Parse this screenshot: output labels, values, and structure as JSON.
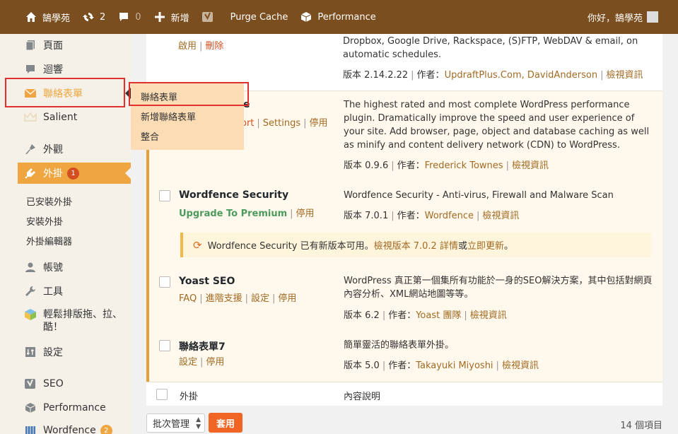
{
  "adminbar": {
    "site_name": "鵠學苑",
    "updates_count": "2",
    "comments_count": "0",
    "new_label": "新增",
    "purge_cache": "Purge Cache",
    "performance": "Performance",
    "greeting": "你好，鵠學苑"
  },
  "sidebar": {
    "pages": "頁面",
    "comments": "迴響",
    "contact_forms": "聯絡表單",
    "salient": "Salient",
    "appearance": "外觀",
    "plugins": "外掛",
    "plugins_badge": "1",
    "installed_plugins": "已安裝外掛",
    "add_plugin": "安裝外掛",
    "plugin_editor": "外掛編輯器",
    "users": "帳號",
    "tools": "工具",
    "builder_line1": "輕鬆排版拖、拉、",
    "builder_line2": "酷！",
    "settings": "設定",
    "seo": "SEO",
    "performance": "Performance",
    "wordfence": "Wordfence",
    "wordfence_badge": "2"
  },
  "flyout": {
    "item1": "聯絡表單",
    "item2": "新增聯絡表單",
    "item3": "整合"
  },
  "plugins": {
    "updraft": {
      "action_enable": "啟用",
      "action_delete": "刪除",
      "desc": "Dropbox, Google Drive, Rackspace, (S)FTP, WebDAV & email, on automatic schedules.",
      "version": "版本 2.14.2.22",
      "author_label": "作者：",
      "author": "UpdraftPlus.Com, DavidAnderson",
      "details": "檢視資訊"
    },
    "w3tc": {
      "name_fragment": "he",
      "action_support_fragment": "ort",
      "action_settings": "Settings",
      "action_deactivate": "停用",
      "desc": "The highest rated and most complete WordPress performance plugin. Dramatically improve the speed and user experience of your site. Add browser, page, object and database caching as well as minify and content delivery network (CDN) to WordPress.",
      "version": "版本 0.9.6",
      "author_label": "作者：",
      "author": "Frederick Townes",
      "details": "檢視資訊"
    },
    "wordfence": {
      "name": "Wordfence Security",
      "action_premium": "Upgrade To Premium",
      "action_deactivate": "停用",
      "desc": "Wordfence Security - Anti-virus, Firewall and Malware Scan",
      "version": "版本 7.0.1",
      "author_label": "作者：",
      "author": "Wordfence",
      "details": "檢視資訊",
      "update_text": "Wordfence Security 已有新版本可用。",
      "update_link1": "檢視版本 7.0.2 詳情",
      "update_or": "或",
      "update_link2": "立即更新",
      "update_end": "。"
    },
    "yoast": {
      "name": "Yoast SEO",
      "action_faq": "FAQ",
      "action_support": "進階支援",
      "action_settings": "設定",
      "action_deactivate": "停用",
      "desc": "WordPress 真正第一個集所有功能於一身的SEO解決方案，其中包括對網頁內容分析、XML網站地圖等等。",
      "version": "版本 6.2",
      "author_label": "作者：",
      "author": "Yoast 團隊",
      "details": "檢視資訊"
    },
    "cf7": {
      "name": "聯絡表單7",
      "action_settings": "設定",
      "action_deactivate": "停用",
      "desc": "簡單靈活的聯絡表單外掛。",
      "version": "版本 5.0",
      "author_label": "作者：",
      "author": "Takayuki Miyoshi",
      "details": "檢視資訊"
    }
  },
  "table_footer": {
    "col_plugin": "外掛",
    "col_desc": "內容說明"
  },
  "bulk": {
    "select_label": "批次管理",
    "apply": "套用",
    "count": "14 個項目"
  },
  "colors": {
    "adminbar": "#7a4e1e",
    "accent": "#f0a640",
    "link": "#a26a22",
    "highlight": "#e03030"
  }
}
